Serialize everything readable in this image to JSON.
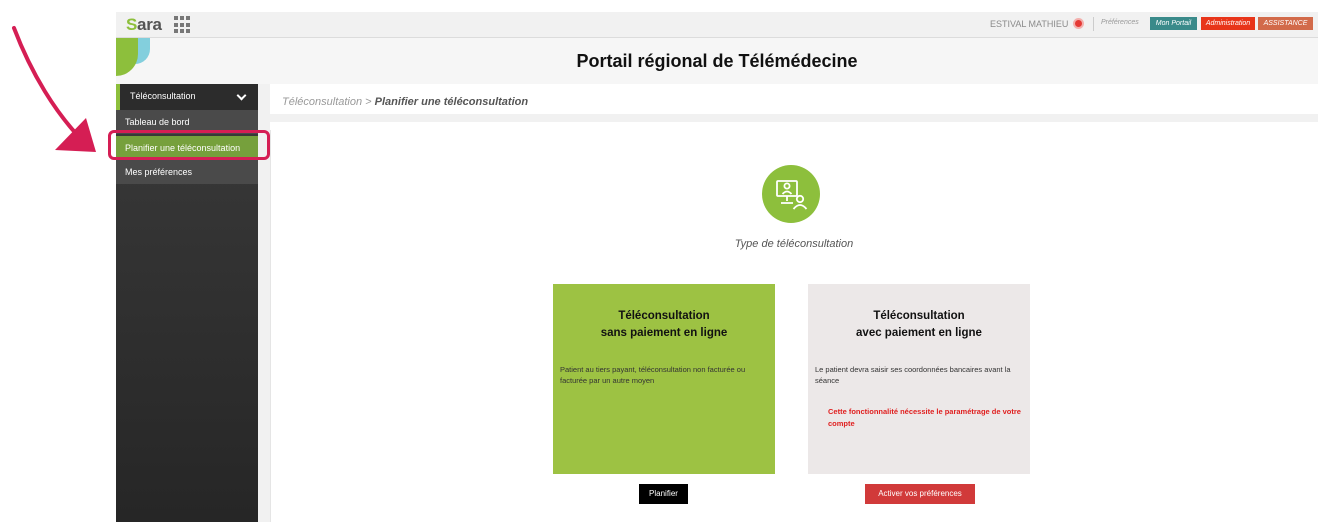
{
  "topbar": {
    "logo": "ara",
    "user_name": "ESTIVAL MATHIEU",
    "prefs_label": "Préférences",
    "buttons": [
      "Mon Portail",
      "Administration",
      "ASSISTANCE"
    ]
  },
  "header": {
    "title": "Portail régional de Télémédecine"
  },
  "sidebar": {
    "section": "Téléconsultation",
    "items": [
      "Tableau de bord",
      "Planifier une téléconsultation",
      "Mes préférences"
    ],
    "active_index": 1
  },
  "breadcrumb": {
    "parent": "Téléconsultation >",
    "current": "Planifier une téléconsultation"
  },
  "main": {
    "type_label": "Type de téléconsultation",
    "cards": [
      {
        "title_line1": "Téléconsultation",
        "title_line2": "sans paiement en ligne",
        "description": "Patient au tiers payant, téléconsultation non facturée ou facturée par un autre moyen",
        "button": "Planifier",
        "color": "#9dc243"
      },
      {
        "title_line1": "Téléconsultation",
        "title_line2": "avec paiement en ligne",
        "description": "Le patient devra saisir ses coordonnées bancaires avant la séance",
        "warning": "Cette fonctionnalité nécessite le paramétrage de votre compte",
        "button": "Activer vos préférences",
        "color": "#ece8e8"
      }
    ]
  },
  "colors": {
    "accent": "#8dbf3c",
    "annotation": "#d51e54",
    "warning": "#e02020"
  },
  "icons": [
    "apps-grid-icon",
    "user-status-icon",
    "chevron-down-icon",
    "teleconsultation-icon",
    "annotation-arrow-icon"
  ]
}
